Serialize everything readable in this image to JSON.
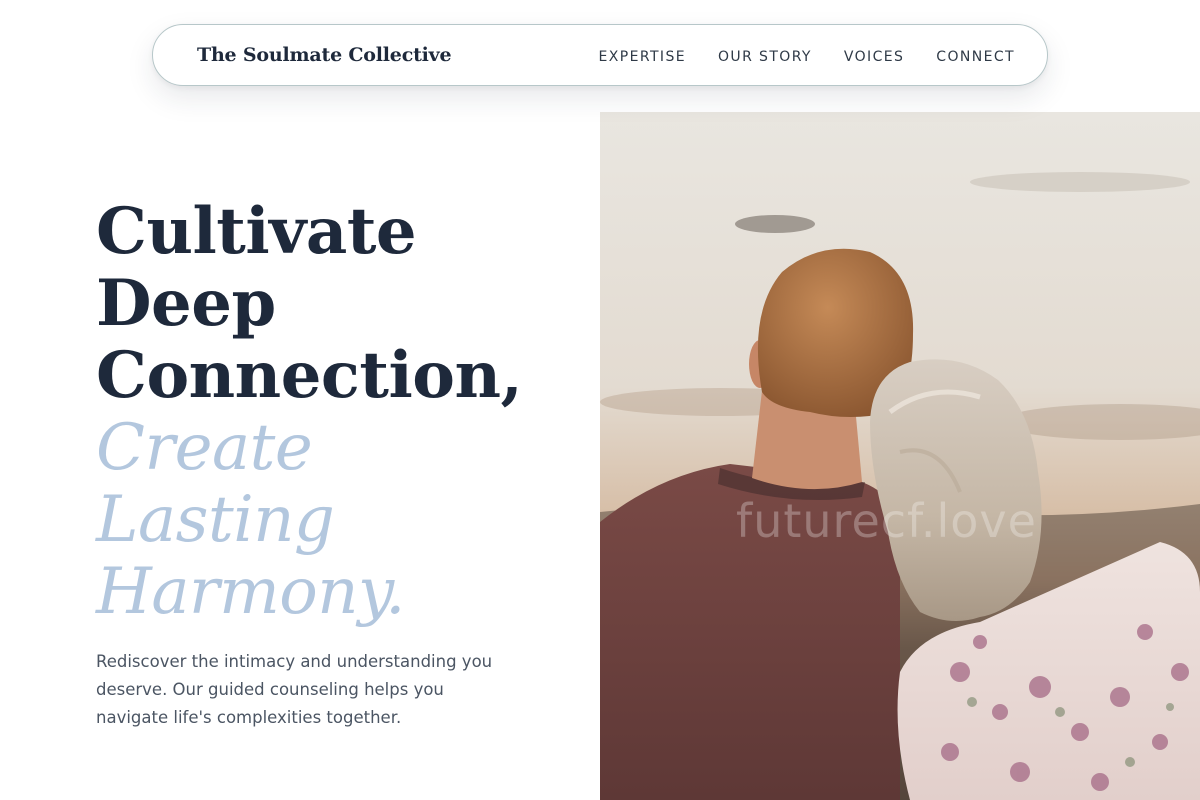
{
  "header": {
    "brand": "The Soulmate Collective",
    "nav": [
      {
        "label": "EXPERTISE"
      },
      {
        "label": "OUR STORY"
      },
      {
        "label": "VOICES"
      },
      {
        "label": "CONNECT"
      }
    ]
  },
  "hero": {
    "headline_lines": [
      "Cultivate",
      "Deep",
      "Connection,"
    ],
    "accent_lines": [
      "Create",
      "Lasting",
      "Harmony."
    ],
    "subtext": "Rediscover the intimacy and understanding you deserve. Our guided counseling helps you navigate life's complexities together.",
    "image": {
      "description_icon": "couple-photo",
      "watermark": "futurecf.love"
    }
  },
  "colors": {
    "text_dark": "#1e293b",
    "accent_blue": "#b3c7de",
    "body_text": "#4b5563",
    "nav_border": "#b7c7c9"
  }
}
